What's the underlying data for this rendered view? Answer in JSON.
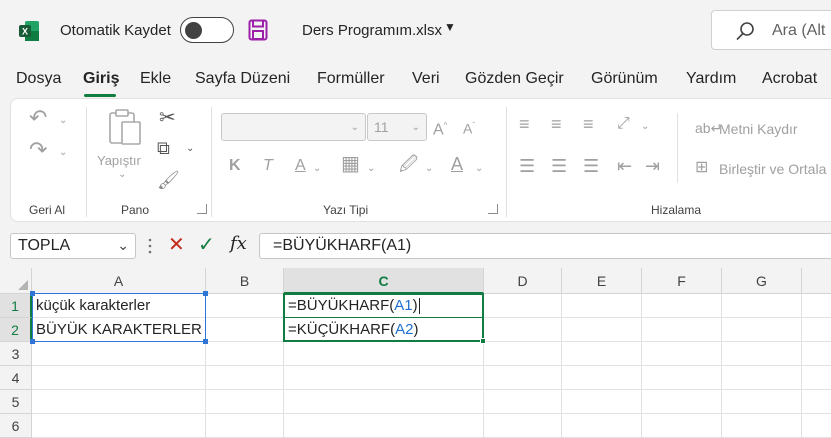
{
  "titlebar": {
    "autosave_label": "Otomatik Kaydet",
    "filename": "Ders Programım.xlsx",
    "search_placeholder": "Ara (Alt"
  },
  "tabs": [
    {
      "label": "Dosya"
    },
    {
      "label": "Giriş",
      "active": true
    },
    {
      "label": "Ekle"
    },
    {
      "label": "Sayfa Düzeni"
    },
    {
      "label": "Formüller"
    },
    {
      "label": "Veri"
    },
    {
      "label": "Gözden Geçir"
    },
    {
      "label": "Görünüm"
    },
    {
      "label": "Yardım"
    },
    {
      "label": "Acrobat"
    }
  ],
  "ribbon": {
    "undo_group_label": "Geri Al",
    "clipboard_group_label": "Pano",
    "paste_label": "Yapıştır",
    "font_group_label": "Yazı Tipi",
    "font_size": "11",
    "align_group_label": "Hizalama",
    "wrap_text_label": "Metni Kaydır",
    "merge_label": "Birleştir ve Ortala"
  },
  "formula_bar": {
    "name_box": "TOPLA",
    "formula": "=BÜYÜKHARF(A1)"
  },
  "grid": {
    "columns": [
      "A",
      "B",
      "C",
      "D",
      "E",
      "F",
      "G"
    ],
    "rows": [
      "1",
      "2",
      "3",
      "4",
      "5",
      "6"
    ],
    "cells": {
      "A1": "küçük karakterler",
      "A2": "BÜYÜK KARAKTERLER",
      "C1_prefix": "=BÜYÜKHARF(",
      "C1_ref": "A1",
      "C1_suffix": ")",
      "C2_prefix": "=KÜÇÜKHARF(",
      "C2_ref": "A2",
      "C2_suffix": ")"
    }
  },
  "colors": {
    "accent": "#107c41",
    "reference": "#2e75d6",
    "cancel": "#c42b1c"
  }
}
